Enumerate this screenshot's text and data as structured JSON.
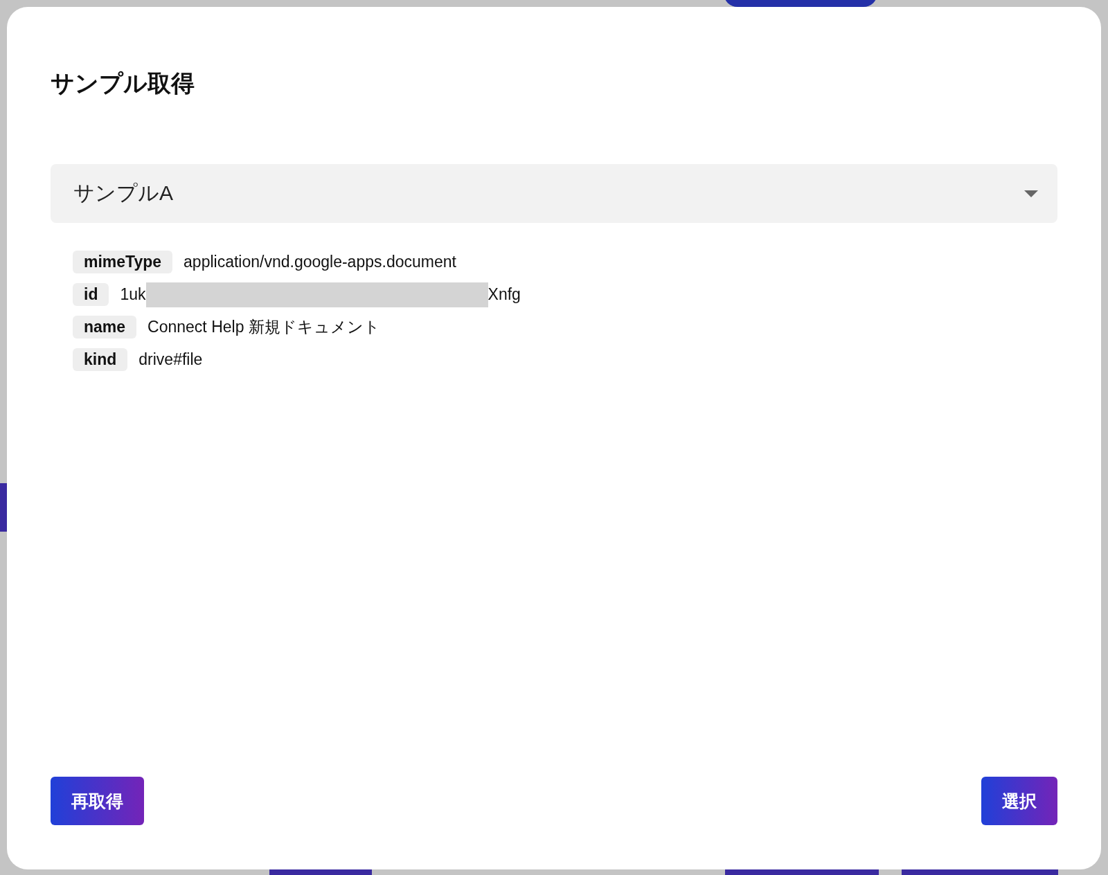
{
  "dialog": {
    "title": "サンプル取得",
    "select": {
      "value": "サンプルA"
    },
    "fields": [
      {
        "kind": "text",
        "key": "mimeType",
        "value": "application/vnd.google-apps.document"
      },
      {
        "kind": "redacted",
        "key": "id",
        "value_start": "1uk",
        "value_end": "Xnfg"
      },
      {
        "kind": "text",
        "key": "name",
        "value": "Connect Help 新規ドキュメント"
      },
      {
        "kind": "text",
        "key": "kind",
        "value": "drive#file"
      }
    ],
    "buttons": [
      {
        "label": "再取得"
      },
      {
        "label": "選択"
      }
    ]
  }
}
